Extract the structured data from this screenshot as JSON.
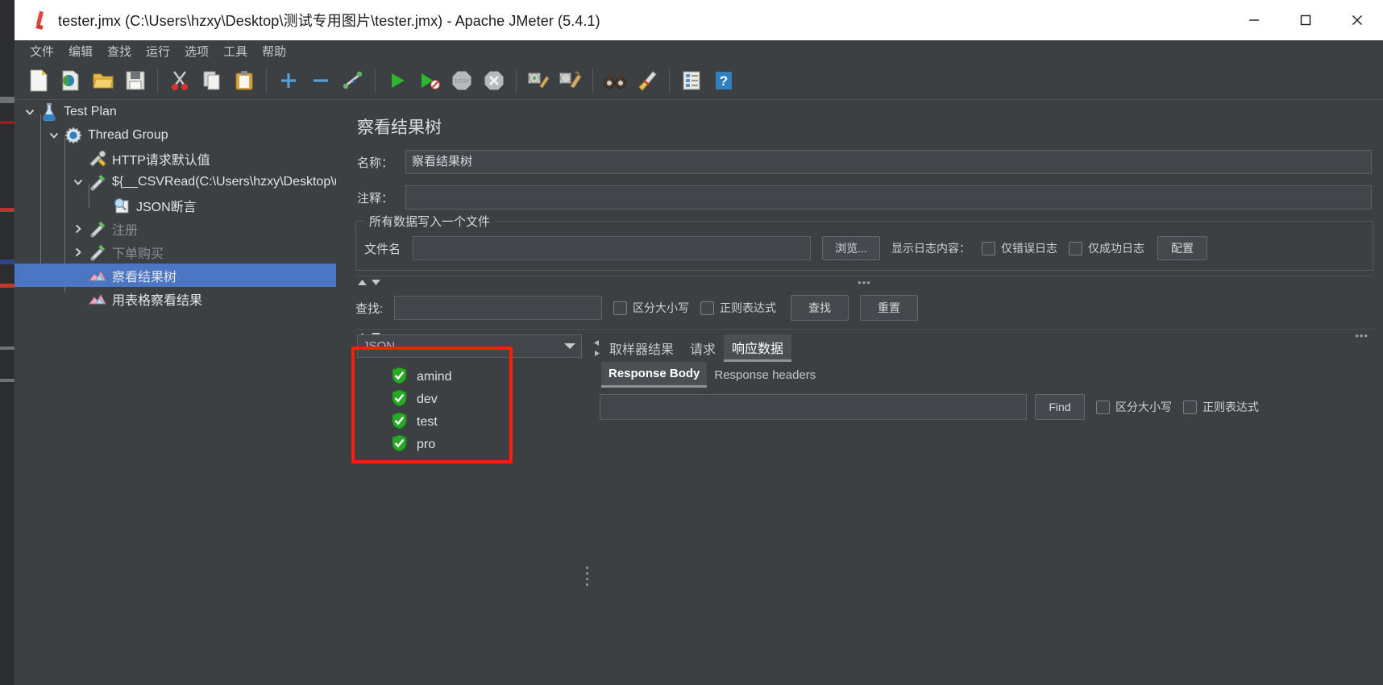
{
  "window": {
    "title": "tester.jmx (C:\\Users\\hzxy\\Desktop\\测试专用图片\\tester.jmx) - Apache JMeter (5.4.1)",
    "app_icon": "jmeter-feather-icon",
    "controls": [
      {
        "name": "minimize-button",
        "glyph": "minimize-icon"
      },
      {
        "name": "maximize-button",
        "glyph": "maximize-icon"
      },
      {
        "name": "close-button",
        "glyph": "close-icon"
      }
    ]
  },
  "menubar": {
    "items": [
      {
        "label": "文件",
        "name": "menu-file"
      },
      {
        "label": "编辑",
        "name": "menu-edit"
      },
      {
        "label": "查找",
        "name": "menu-search"
      },
      {
        "label": "运行",
        "name": "menu-run"
      },
      {
        "label": "选项",
        "name": "menu-options"
      },
      {
        "label": "工具",
        "name": "menu-tools"
      },
      {
        "label": "帮助",
        "name": "menu-help"
      }
    ]
  },
  "toolbar": {
    "buttons": [
      {
        "name": "new-icon",
        "kind": "new"
      },
      {
        "name": "templates-icon",
        "kind": "templates"
      },
      {
        "name": "open-icon",
        "kind": "open"
      },
      {
        "name": "save-icon",
        "kind": "save"
      },
      {
        "sep": true
      },
      {
        "name": "cut-icon",
        "kind": "cut"
      },
      {
        "name": "copy-icon",
        "kind": "copy"
      },
      {
        "name": "paste-icon",
        "kind": "paste"
      },
      {
        "sep": true
      },
      {
        "name": "expand-all-icon",
        "kind": "plus"
      },
      {
        "name": "collapse-all-icon",
        "kind": "minus"
      },
      {
        "name": "toggle-icon",
        "kind": "toggle"
      },
      {
        "sep": true
      },
      {
        "name": "start-icon",
        "kind": "start"
      },
      {
        "name": "start-no-pauses-icon",
        "kind": "start-no-pause"
      },
      {
        "name": "stop-icon",
        "kind": "stop"
      },
      {
        "name": "shutdown-icon",
        "kind": "shutdown"
      },
      {
        "sep": true
      },
      {
        "name": "clear-icon",
        "kind": "clear"
      },
      {
        "name": "clear-all-icon",
        "kind": "clear-all"
      },
      {
        "sep": true
      },
      {
        "name": "search-icon",
        "kind": "binoculars"
      },
      {
        "name": "reset-search-icon",
        "kind": "broom"
      },
      {
        "sep": true
      },
      {
        "name": "function-helper-icon",
        "kind": "function"
      },
      {
        "name": "help-icon",
        "kind": "help"
      }
    ]
  },
  "tree": {
    "items": [
      {
        "label": "Test Plan",
        "name": "tree-node-test-plan",
        "indent": 0,
        "toggle": "expanded",
        "icon": "test-plan-icon",
        "dim": false,
        "selected": false
      },
      {
        "label": "Thread Group",
        "name": "tree-node-thread-group",
        "indent": 30,
        "toggle": "expanded",
        "icon": "thread-group-icon",
        "dim": false,
        "selected": false
      },
      {
        "label": "HTTP请求默认值",
        "name": "tree-node-http-defaults",
        "indent": 60,
        "toggle": "none",
        "icon": "http-defaults-icon",
        "dim": false,
        "selected": false
      },
      {
        "label": "${__CSVRead(C:\\Users\\hzxy\\Desktop\\use",
        "name": "tree-node-csvread-sampler",
        "indent": 60,
        "toggle": "expanded",
        "icon": "http-sampler-icon",
        "dim": false,
        "selected": false
      },
      {
        "label": "JSON断言",
        "name": "tree-node-json-assertion",
        "indent": 90,
        "toggle": "none",
        "icon": "json-assertion-icon",
        "dim": false,
        "selected": false
      },
      {
        "label": "注册",
        "name": "tree-node-register",
        "indent": 60,
        "toggle": "collapsed",
        "icon": "http-sampler-icon",
        "dim": true,
        "selected": false
      },
      {
        "label": "下单购买",
        "name": "tree-node-place-order",
        "indent": 60,
        "toggle": "collapsed",
        "icon": "http-sampler-icon",
        "dim": true,
        "selected": false
      },
      {
        "label": "察看结果树",
        "name": "tree-node-view-results-tree",
        "indent": 60,
        "toggle": "none",
        "icon": "view-results-tree-icon",
        "dim": false,
        "selected": true
      },
      {
        "label": "用表格察看结果",
        "name": "tree-node-view-results-table",
        "indent": 60,
        "toggle": "none",
        "icon": "view-results-tree-icon",
        "dim": false,
        "selected": false
      }
    ]
  },
  "panel": {
    "title": "察看结果树",
    "name_label": "名称：",
    "name_value": "察看结果树",
    "comment_label": "注释：",
    "comment_value": "",
    "file_group": {
      "title": "所有数据写入一个文件",
      "filename_label": "文件名",
      "filename_value": "",
      "browse_button": "浏览...",
      "log_display_label": "显示日志内容：",
      "errors_only_checkbox": "仅错误日志",
      "success_only_checkbox": "仅成功日志",
      "configure_button": "配置"
    },
    "search": {
      "label": "查找:",
      "value": "",
      "case_sensitive_checkbox": "区分大小写",
      "regex_checkbox": "正则表达式",
      "search_button": "查找",
      "reset_button": "重置"
    },
    "splitter_dots": "•••"
  },
  "results": {
    "renderer_combo_value": "JSON",
    "items": [
      {
        "label": "amind",
        "name": "result-item-amind",
        "status": "success"
      },
      {
        "label": "dev",
        "name": "result-item-dev",
        "status": "success"
      },
      {
        "label": "test",
        "name": "result-item-test",
        "status": "success"
      },
      {
        "label": "pro",
        "name": "result-item-pro",
        "status": "success"
      }
    ],
    "tabs": [
      {
        "label": "取样器结果",
        "name": "tab-sampler-result",
        "active": false
      },
      {
        "label": "请求",
        "name": "tab-request",
        "active": false
      },
      {
        "label": "响应数据",
        "name": "tab-response-data",
        "active": true
      }
    ],
    "subtabs": [
      {
        "label": "Response Body",
        "name": "subtab-response-body",
        "active": true
      },
      {
        "label": "Response headers",
        "name": "subtab-response-headers",
        "active": false
      }
    ],
    "find": {
      "value": "",
      "button": "Find",
      "case_sensitive_checkbox": "区分大小写",
      "regex_checkbox": "正则表达式"
    },
    "response_body_text": ""
  },
  "annotation": {
    "highlight_color": "#fc1d06",
    "shape": "red-rectangle-highlight"
  },
  "colors": {
    "background": "#3c4043",
    "selection": "#4a76c4",
    "success_green": "#2aa828",
    "titlebar": "#ffffff"
  }
}
